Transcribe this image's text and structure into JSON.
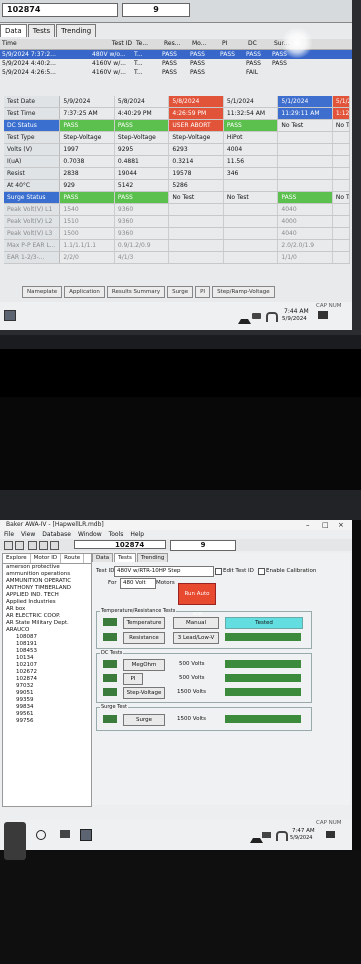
{
  "photo1": {
    "header": {
      "id_box": "102874",
      "count_box": "9"
    },
    "tabs": [
      "Data",
      "Tests",
      "Trending"
    ],
    "grid": {
      "columns": [
        "Time",
        "Test ID",
        "Te...",
        "Res...",
        "Mo...",
        "PI",
        "DC",
        "Sur..."
      ],
      "rows": [
        [
          "5/9/2024 7:37:2...",
          "480V w/o...",
          "T...",
          "PASS",
          "PASS",
          "PASS",
          "PASS",
          "PASS"
        ],
        [
          "5/9/2024 4:40:2...",
          "4160V w/...",
          "T...",
          "PASS",
          "PASS",
          "",
          "PASS",
          "PASS"
        ],
        [
          "5/9/2024 4:26:5...",
          "4160V w/...",
          "T...",
          "PASS",
          "PASS",
          "",
          "FAIL",
          ""
        ]
      ]
    },
    "results": {
      "labels": [
        "Test Date",
        "Test Time",
        "DC Status",
        "Test Type",
        "Volts (V)",
        "I(uA)",
        "Resist",
        "At 40°C",
        "Surge Status",
        "Peak Volt(V) L1",
        "Peak Volt(V) L2",
        "Peak Volt(V) L3",
        "Max P-P EAR L...",
        "EAR 1-2/3-..."
      ],
      "columns": [
        [
          "5/9/2024",
          "7:37:25 AM",
          "PASS",
          "Step-Voltage",
          "1997",
          "0.7038",
          "2838",
          "929",
          "PASS",
          "1540",
          "1510",
          "1500",
          "1.1/1.1/1.1",
          "2/2/0"
        ],
        [
          "5/8/2024",
          "4:40:29 PM",
          "PASS",
          "Step-Voltage",
          "9295",
          "0.4881",
          "19044",
          "5142",
          "PASS",
          "9360",
          "9360",
          "9360",
          "0.9/1.2/0.9",
          "4/1/3"
        ],
        [
          "5/8/2024",
          "4:26:59 PM",
          "USER ABORT",
          "Step-Voltage",
          "6293",
          "0.3214",
          "19578",
          "5286",
          "No Test",
          "",
          "",
          "",
          "",
          ""
        ],
        [
          "5/1/2024",
          "11:32:54 AM",
          "PASS",
          "HiPot",
          "4004",
          "11.56",
          "346",
          "",
          "No Test",
          "",
          "",
          "",
          "",
          ""
        ],
        [
          "5/1/2024",
          "11:29:11 AM",
          "No Test",
          "",
          "",
          "",
          "",
          "",
          "PASS",
          "4040",
          "4000",
          "4040",
          "2.0/2.0/1.9",
          "1/1/0"
        ],
        [
          "5/1/2",
          "1:12",
          "No Te",
          "",
          "",
          "",
          "",
          "",
          "No Te",
          "",
          "",
          "",
          "",
          ""
        ]
      ]
    },
    "bottom_tabs": [
      "Nameplate",
      "Application",
      "Results Summary",
      "Surge",
      "PI",
      "Step/Ramp-Voltage"
    ],
    "taskbar": {
      "indicator": "CAP NUM",
      "time": "7:44 AM",
      "date": "5/9/2024"
    }
  },
  "photo3": {
    "title": "Baker AWA-IV - [HapwellLR.mdb]",
    "menu": [
      "File",
      "View",
      "Database",
      "Window",
      "Tools",
      "Help"
    ],
    "toolbar": {
      "id_box": "102874",
      "count_box": "9"
    },
    "sidebar": {
      "tabs": [
        "Explore",
        "Motor ID",
        "Route"
      ],
      "items": [
        "amerson protective",
        "ammunition operations",
        "AMMUNITION OPERATIC",
        "ANTHONY TIMBERLAND",
        "APPLIED IND. TECH",
        "Applied Industries",
        "AR box",
        "AR ELECTRIC COOP.",
        "AR State Military Dept.",
        "ARAUCO"
      ],
      "subitems": [
        "108087",
        "108191",
        "108453",
        "10134",
        "102107",
        "102672",
        "102874",
        "97032",
        "99051",
        "99359",
        "99834",
        "99561",
        "99756"
      ]
    },
    "main_tabs": [
      "Data",
      "Tests",
      "Trending"
    ],
    "test_id_label": "Test ID",
    "test_id_value": "480V w/RTR-10HP Step",
    "edit_test_id": "Edit Test ID",
    "enable_calibration": "Enable Calibration",
    "for_label": "For",
    "for_value": "480 Volt",
    "motors_label": "Motors",
    "run_auto": "Run Auto Test",
    "groups": {
      "temp": "Temperature/Resistance Tests",
      "dc": "DC Tests",
      "surge": "Surge Test"
    },
    "buttons": {
      "temperature": "Temperature",
      "manual": "Manual",
      "tested": "Tested",
      "resistance": "Resistance",
      "lead": "3 Lead/Low-V",
      "megohm": "MegOhm",
      "pi": "PI",
      "step_voltage": "Step-Voltage",
      "surge": "Surge"
    },
    "values": {
      "megohm_v": "500 Volts",
      "pi_v": "500 Volts",
      "step_v": "1500 Volts",
      "surge_v": "1500 Volts"
    },
    "status": {
      "indicator": "CAP NUM",
      "time": "7:47 AM",
      "date": "5/9/2024"
    }
  }
}
